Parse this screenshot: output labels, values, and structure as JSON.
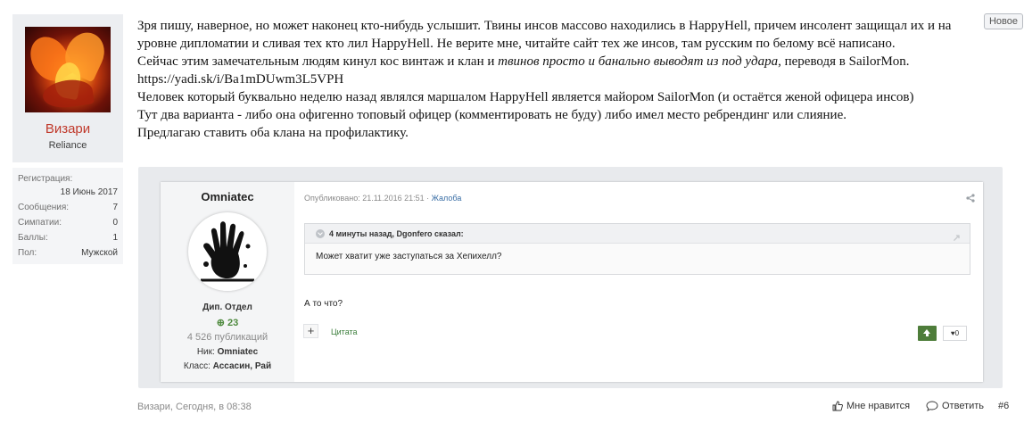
{
  "author": {
    "name": "Визари",
    "group": "Reliance",
    "stats": [
      {
        "label": "Регистрация:",
        "value": "18 Июнь 2017"
      },
      {
        "label": "Сообщения:",
        "value": "7"
      },
      {
        "label": "Симпатии:",
        "value": "0"
      },
      {
        "label": "Баллы:",
        "value": "1"
      },
      {
        "label": "Пол:",
        "value": "Мужской"
      }
    ]
  },
  "badge": "Новое",
  "post": {
    "p1": "Зря пишу, наверное, но может наконец кто-нибудь услышит. Твины инсов массово находились в HappyHell, причем инсолент защищал их и на уровне дипломатии и сливая тех кто лил HappyHell. Не верите мне, читайте сайт тех же инсов, там русским по белому всё написано.",
    "p2_start": "Сейчас этим замечательным людям кинул кос винтаж и клан и ",
    "p2_italic": "твинов просто и банально выводят из под удара",
    "p2_end": ", переводя в SailorMon.",
    "p3": "https://yadi.sk/i/Ba1mDUwm3L5VPH",
    "p4": "Человек который буквально неделю назад являлся маршалом HappyHell является майором SailorMon (и остаётся женой офицера инсов)",
    "p5": "Тут два варианта - либо она офигенно топовый офицер (комментировать не буду) либо имел место ребрендинг или слияние.",
    "p6": "Предлагаю ставить оба клана на профилактику."
  },
  "embed": {
    "user_name": "Omniatec",
    "group": "Дип. Отдел",
    "reputation": "23",
    "posts": "4 526 публикаций",
    "nick_label": "Ник:",
    "nick_value": "Omniatec",
    "class_label": "Класс:",
    "class_value": "Ассасин, Рай",
    "meta": "Опубликовано: 21.11.2016 21:51",
    "complaint": "Жалоба",
    "quote_header": "4 минуты назад, Dgonfero сказал:",
    "quote_text": "Может хватит уже заступаться за Хепихелл?",
    "reply_text": "А то что?",
    "quote_button": "Цитата",
    "rep_count": "0"
  },
  "footer": {
    "byline": "Визари, Сегодня, в 08:38",
    "like": "Мне нравится",
    "reply": "Ответить",
    "post_number": "#6"
  },
  "colors": {
    "author_name": "#c0392b",
    "accent_green": "#4e7d3a",
    "link_blue": "#3a6ea5"
  }
}
